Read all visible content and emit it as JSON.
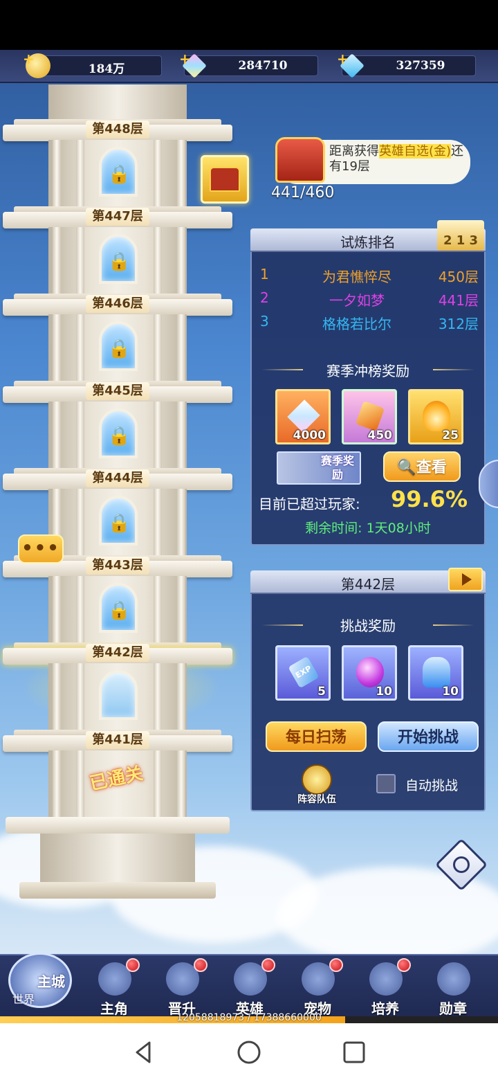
{
  "resources": [
    {
      "name": "gold",
      "value": "184万",
      "icon": "gold-coin-icon"
    },
    {
      "name": "crystal",
      "value": "284710",
      "icon": "rainbow-gem-icon"
    },
    {
      "name": "diamond",
      "value": "327359",
      "icon": "blue-diamond-icon"
    }
  ],
  "tower": {
    "floors": [
      {
        "label": "第448层",
        "state": "locked"
      },
      {
        "label": "第447层",
        "state": "locked"
      },
      {
        "label": "第446层",
        "state": "locked"
      },
      {
        "label": "第445层",
        "state": "locked"
      },
      {
        "label": "第444层",
        "state": "locked"
      },
      {
        "label": "第443层",
        "state": "locked"
      },
      {
        "label": "第442层",
        "state": "current"
      },
      {
        "label": "第441层",
        "state": "cleared"
      }
    ],
    "cleared_text": "已通关"
  },
  "reward_tip": {
    "prefix": "距离获得",
    "highlight": "英雄自选(金)",
    "suffix": "还有19层",
    "progress": "441/460"
  },
  "ranking": {
    "title": "试炼排名",
    "rows": [
      {
        "rank": "1",
        "name": "为君憔悴尽",
        "floor": "450层",
        "color": "#f0a22a"
      },
      {
        "rank": "2",
        "name": "一夕如梦",
        "floor": "441层",
        "color": "#e040e6"
      },
      {
        "rank": "3",
        "name": "格格若比尔",
        "floor": "312层",
        "color": "#35b8f2"
      }
    ],
    "season_title": "赛季冲榜奖励",
    "season_items": [
      {
        "count": "4000",
        "icon": "rainbow-diamond-icon"
      },
      {
        "count": "450",
        "icon": "amber-crystal-icon"
      },
      {
        "count": "25",
        "icon": "flame-essence-icon"
      }
    ],
    "season_badge": "赛季奖励",
    "view_button": "查看",
    "exceed_label": "目前已超过玩家:",
    "exceed_value": "99.6%",
    "remaining": "剩余时间: 1天08小时"
  },
  "challenge": {
    "title": "第442层",
    "reward_title": "挑战奖励",
    "items": [
      {
        "count": "5",
        "icon": "exp-crystal-icon"
      },
      {
        "count": "10",
        "icon": "purple-orb-icon"
      },
      {
        "count": "10",
        "icon": "blue-potion-icon"
      }
    ],
    "sweep_button": "每日扫荡",
    "start_button": "开始挑战",
    "lineup_label": "阵容队伍",
    "auto_label": "自动挑战"
  },
  "nav": {
    "home_main": "主城",
    "home_sub": "世界",
    "items": [
      {
        "label": "主角",
        "icon": "hero-helmet-icon"
      },
      {
        "label": "晋升",
        "icon": "promotion-crown-icon"
      },
      {
        "label": "英雄",
        "icon": "hero-shield-icon"
      },
      {
        "label": "宠物",
        "icon": "pet-beast-icon"
      },
      {
        "label": "培养",
        "icon": "cultivate-star-icon"
      },
      {
        "label": "勋章",
        "icon": "medal-icon"
      }
    ],
    "exp": "12058818973 / 17388660000",
    "exp_fraction": 0.693
  }
}
